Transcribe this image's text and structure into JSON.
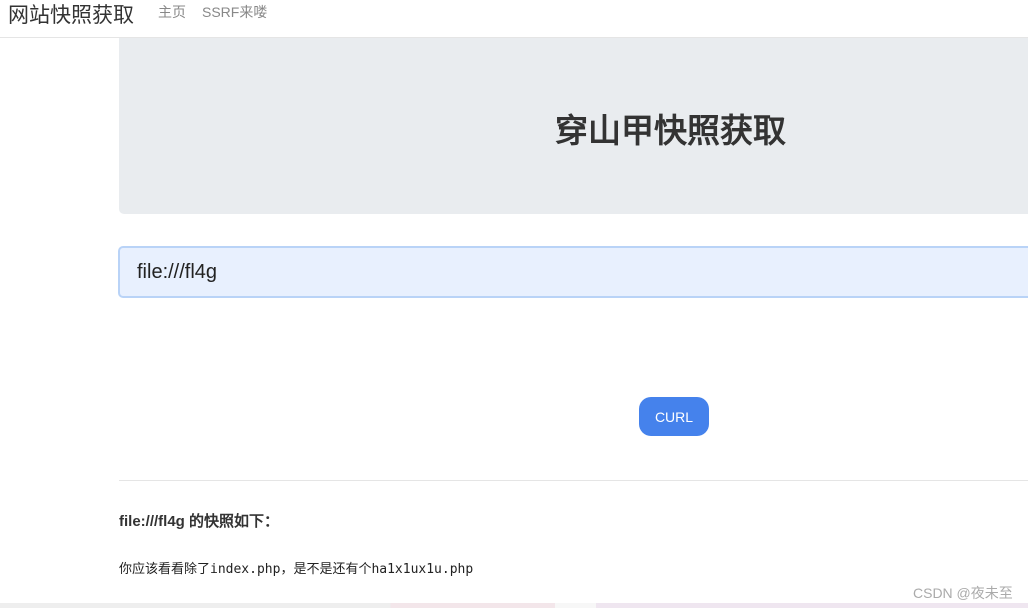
{
  "nav": {
    "brand": "网站快照获取",
    "links": [
      "主页",
      "SSRF来喽"
    ]
  },
  "jumbotron": {
    "title": "穿山甲快照获取"
  },
  "url_input": {
    "value": "file:///fl4g"
  },
  "curl_button": "CURL",
  "result": {
    "title": "file:///fl4g 的快照如下：",
    "body": "你应该看看除了index.php，是不是还有个ha1x1ux1u.php"
  },
  "watermark": "CSDN @夜未至",
  "colors": {
    "button": "#4582ec",
    "jumbotron": "#e9ecef",
    "input_bg": "#e8f0fe"
  }
}
